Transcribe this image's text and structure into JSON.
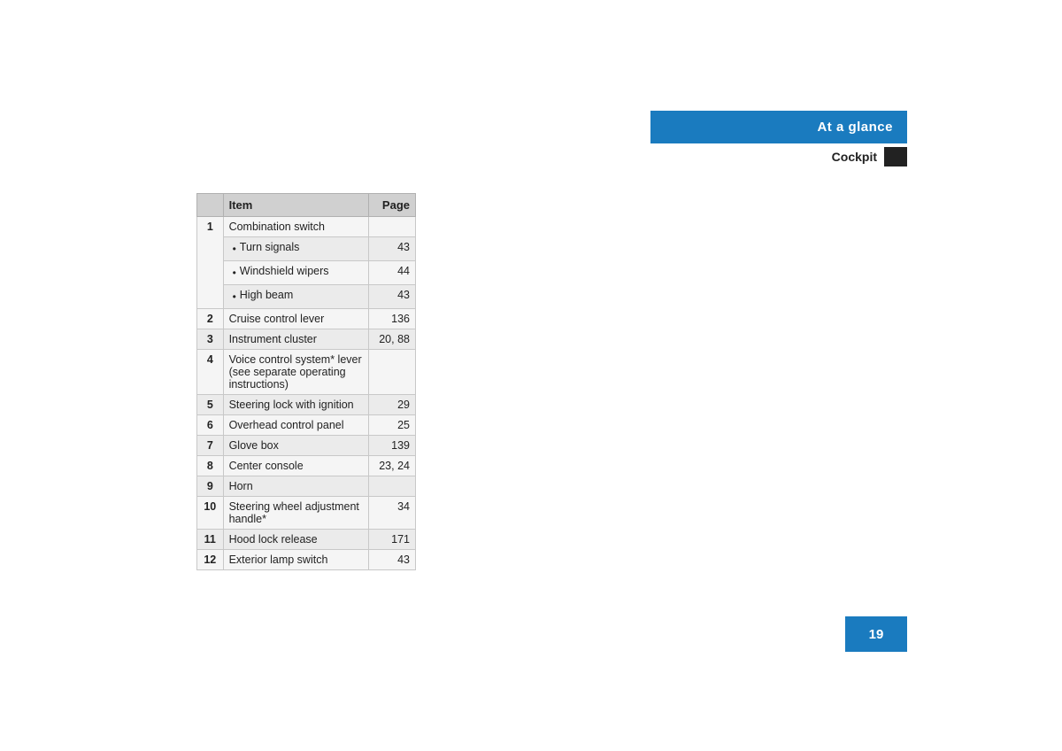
{
  "header": {
    "blue_label": "At a glance",
    "sub_label": "Cockpit"
  },
  "table": {
    "col_item": "Item",
    "col_page": "Page",
    "rows": [
      {
        "num": "1",
        "item": "Combination switch",
        "page": "",
        "sub_items": [
          {
            "label": "Turn signals",
            "page": "43"
          },
          {
            "label": "Windshield wipers",
            "page": "44"
          },
          {
            "label": "High beam",
            "page": "43"
          }
        ]
      },
      {
        "num": "2",
        "item": "Cruise control lever",
        "page": "136",
        "sub_items": []
      },
      {
        "num": "3",
        "item": "Instrument cluster",
        "page": "20, 88",
        "sub_items": []
      },
      {
        "num": "4",
        "item": "Voice control system* lever (see separate operating instructions)",
        "page": "",
        "sub_items": []
      },
      {
        "num": "5",
        "item": "Steering lock with ignition",
        "page": "29",
        "sub_items": []
      },
      {
        "num": "6",
        "item": "Overhead control panel",
        "page": "25",
        "sub_items": []
      },
      {
        "num": "7",
        "item": "Glove box",
        "page": "139",
        "sub_items": []
      },
      {
        "num": "8",
        "item": "Center console",
        "page": "23, 24",
        "sub_items": []
      },
      {
        "num": "9",
        "item": "Horn",
        "page": "",
        "sub_items": []
      },
      {
        "num": "10",
        "item": "Steering wheel adjustment handle*",
        "page": "34",
        "sub_items": []
      },
      {
        "num": "11",
        "item": "Hood lock release",
        "page": "171",
        "sub_items": []
      },
      {
        "num": "12",
        "item": "Exterior lamp switch",
        "page": "43",
        "sub_items": []
      }
    ]
  },
  "page_number": "19"
}
